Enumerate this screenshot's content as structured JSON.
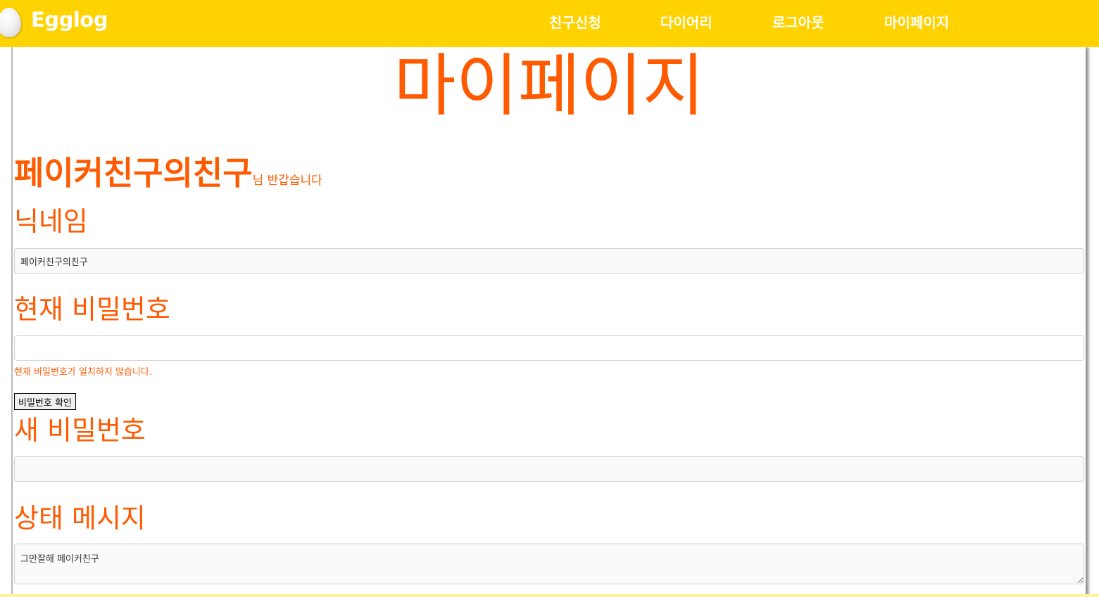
{
  "brand": {
    "name": "Egglog",
    "logo_icon": "egg-icon",
    "bar_color": "#ffd200",
    "accent_color": "#ff5a00"
  },
  "nav": {
    "items": [
      {
        "label": "친구신청"
      },
      {
        "label": "다이어리"
      },
      {
        "label": "로그아웃"
      },
      {
        "label": "마이페이지"
      }
    ]
  },
  "page": {
    "title": "마이페이지",
    "greeting_name": "페이커친구의친구",
    "greeting_suffix": "님 반갑습니다"
  },
  "form": {
    "nickname": {
      "label": "닉네임",
      "value": "페이커친구의친구"
    },
    "current_password": {
      "label": "현재 비밀번호",
      "value": "",
      "error": "현재 비밀번호가 일치하지 않습니다.",
      "confirm_label": "비밀번호 확인"
    },
    "new_password": {
      "label": "새 비밀번호",
      "value": ""
    },
    "status_message": {
      "label": "상태 메시지",
      "value": "그만잘해 페이커친구"
    }
  }
}
